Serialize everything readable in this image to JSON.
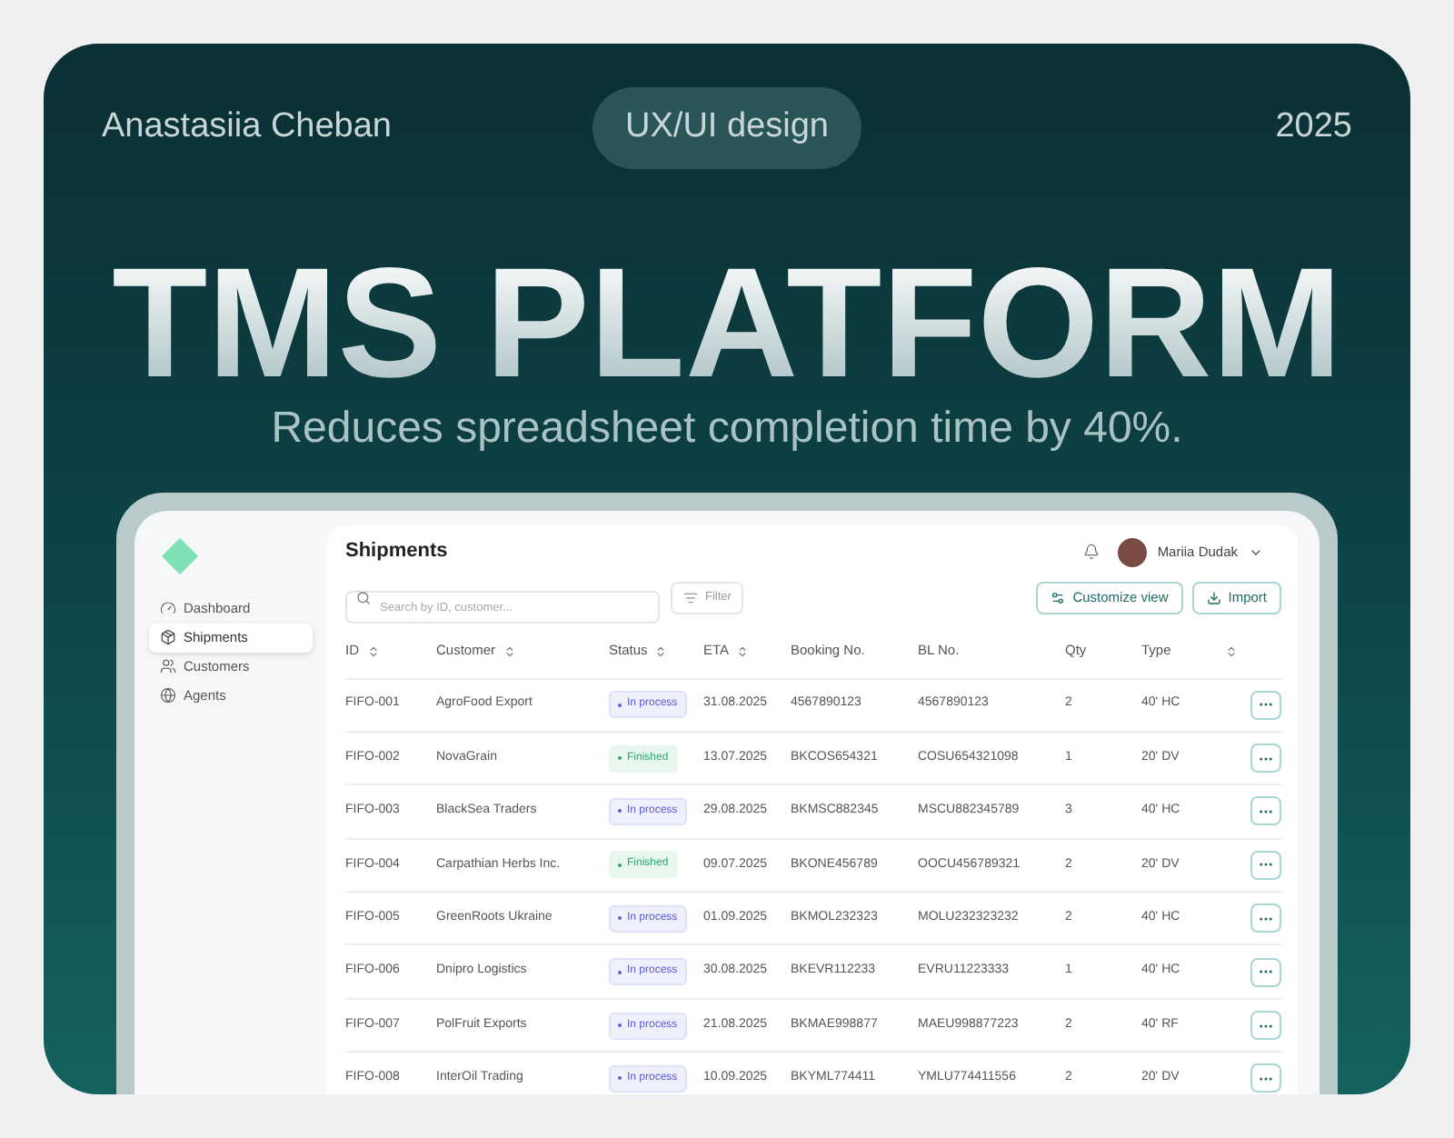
{
  "header": {
    "author": "Anastasiia Cheban",
    "tag": "UX/UI design",
    "year": "2025"
  },
  "title": "TMS PLATFORM",
  "subtitle": "Reduces spreadsheet completion time by 40%.",
  "app": {
    "sidebar": {
      "items": [
        {
          "label": "Dashboard",
          "selected": false
        },
        {
          "label": "Shipments",
          "selected": true
        },
        {
          "label": "Customers",
          "selected": false
        },
        {
          "label": "Agents",
          "selected": false
        }
      ]
    },
    "page_title": "Shipments",
    "user": {
      "name": "Mariia Dudak"
    },
    "search": {
      "placeholder": "Search by ID, customer..."
    },
    "filter_button": "Filter",
    "actions": [
      "Customize view",
      "Import"
    ],
    "table": {
      "columns": [
        {
          "label": "ID",
          "sortable": true
        },
        {
          "label": "Customer",
          "sortable": true
        },
        {
          "label": "Status",
          "sortable": true
        },
        {
          "label": "ETA",
          "sortable": true
        },
        {
          "label": "Booking No.",
          "sortable": false
        },
        {
          "label": "BL No.",
          "sortable": false
        },
        {
          "label": "Qty",
          "sortable": false
        },
        {
          "label": "Type",
          "sortable": false
        },
        {
          "sortable": true
        }
      ],
      "rows": [
        {
          "id": "FIFO-001",
          "customer": "AgroFood Export",
          "status": {
            "label": "In process",
            "kind": "process"
          },
          "eta": "31.08.2025",
          "booking": "4567890123",
          "bl": "4567890123",
          "qty": "2",
          "type": "40' HC"
        },
        {
          "id": "FIFO-002",
          "customer": "NovaGrain",
          "status": {
            "label": "Finished",
            "kind": "finished"
          },
          "eta": "13.07.2025",
          "booking": "BKCOS654321",
          "bl": "COSU654321098",
          "qty": "1",
          "type": "20' DV"
        },
        {
          "id": "FIFO-003",
          "customer": "BlackSea Traders",
          "status": {
            "label": "In process",
            "kind": "process"
          },
          "eta": "29.08.2025",
          "booking": "BKMSC882345",
          "bl": "MSCU882345789",
          "qty": "3",
          "type": "40' HC"
        },
        {
          "id": "FIFO-004",
          "customer": "Carpathian Herbs Inc.",
          "status": {
            "label": "Finished",
            "kind": "finished"
          },
          "eta": "09.07.2025",
          "booking": "BKONE456789",
          "bl": "OOCU456789321",
          "qty": "2",
          "type": "20' DV"
        },
        {
          "id": "FIFO-005",
          "customer": "GreenRoots Ukraine",
          "status": {
            "label": "In process",
            "kind": "process"
          },
          "eta": "01.09.2025",
          "booking": "BKMOL232323",
          "bl": "MOLU232323232",
          "qty": "2",
          "type": "40' HC"
        },
        {
          "id": "FIFO-006",
          "customer": "Dnipro Logistics",
          "status": {
            "label": "In process",
            "kind": "process"
          },
          "eta": "30.08.2025",
          "booking": "BKEVR112233",
          "bl": "EVRU11223333",
          "qty": "1",
          "type": "40' HC"
        },
        {
          "id": "FIFO-007",
          "customer": "PolFruit Exports",
          "status": {
            "label": "In process",
            "kind": "process"
          },
          "eta": "21.08.2025",
          "booking": "BKMAE998877",
          "bl": "MAEU998877223",
          "qty": "2",
          "type": "40' RF"
        },
        {
          "id": "FIFO-008",
          "customer": "InterOil Trading",
          "status": {
            "label": "In process",
            "kind": "process"
          },
          "eta": "10.09.2025",
          "booking": "BKYML774411",
          "bl": "YMLU774411556",
          "qty": "2",
          "type": "20' DV"
        }
      ]
    }
  }
}
